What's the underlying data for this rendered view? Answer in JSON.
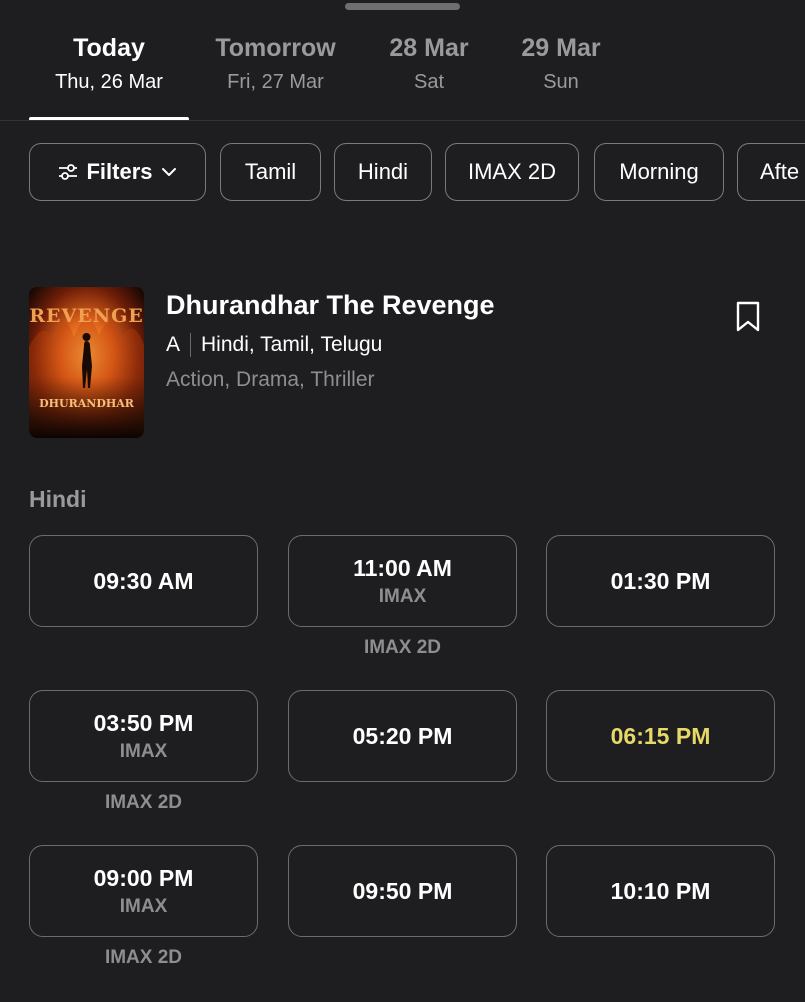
{
  "date_tabs": [
    {
      "label": "Today",
      "sub": "Thu, 26 Mar",
      "active": true
    },
    {
      "label": "Tomorrow",
      "sub": "Fri, 27 Mar",
      "active": false
    },
    {
      "label": "28 Mar",
      "sub": "Sat",
      "active": false
    },
    {
      "label": "29 Mar",
      "sub": "Sun",
      "active": false
    }
  ],
  "filters": {
    "filters_label": "Filters",
    "chips": [
      "Tamil",
      "Hindi",
      "IMAX 2D",
      "Morning",
      "Afte"
    ]
  },
  "movie": {
    "title": "Dhurandhar The Revenge",
    "rating": "A",
    "languages": "Hindi, Tamil, Telugu",
    "genres": "Action, Drama, Thriller",
    "poster_text_top": "REVENGE",
    "poster_text_bottom": "DHURANDHAR"
  },
  "showtimes": {
    "section_label": "Hindi",
    "slots": [
      {
        "time": "09:30 AM",
        "format": "",
        "below": ""
      },
      {
        "time": "11:00 AM",
        "format": "IMAX",
        "below": "IMAX 2D"
      },
      {
        "time": "01:30 PM",
        "format": "",
        "below": ""
      },
      {
        "time": "03:50 PM",
        "format": "IMAX",
        "below": "IMAX 2D"
      },
      {
        "time": "05:20 PM",
        "format": "",
        "below": ""
      },
      {
        "time": "06:15 PM",
        "format": "",
        "below": "",
        "highlight": "#e6d968"
      },
      {
        "time": "09:00 PM",
        "format": "IMAX",
        "below": "IMAX 2D"
      },
      {
        "time": "09:50 PM",
        "format": "",
        "below": ""
      },
      {
        "time": "10:10 PM",
        "format": "",
        "below": ""
      }
    ]
  },
  "colors": {
    "background": "#1e1e20",
    "highlight": "#e6d968",
    "muted": "#8e8e92"
  }
}
